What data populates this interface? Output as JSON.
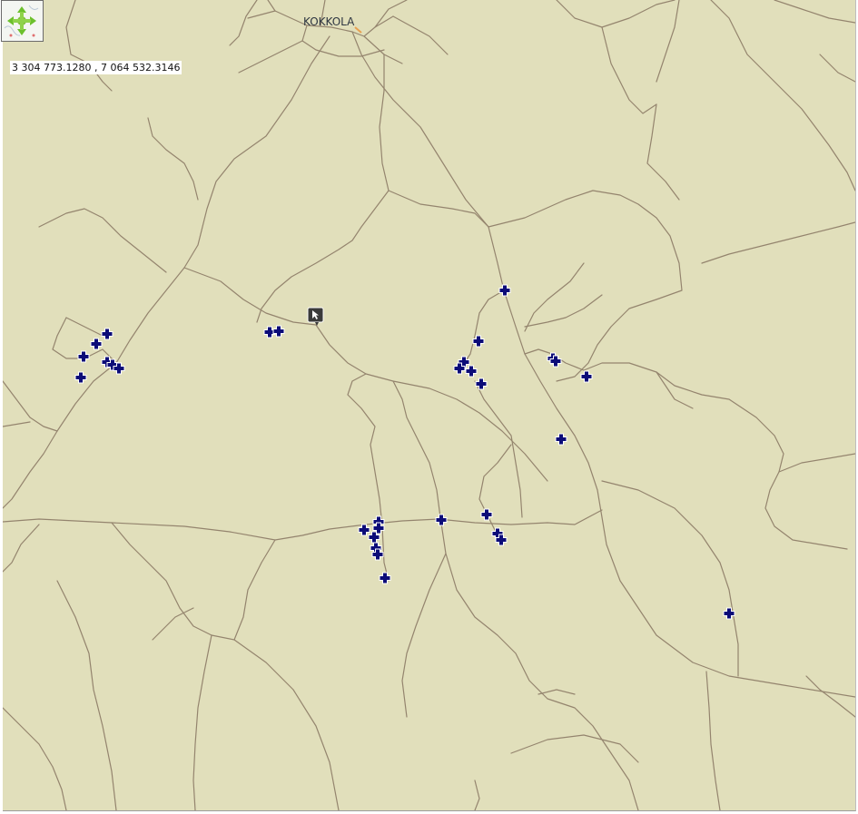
{
  "map": {
    "city_label": "KOKKOLA",
    "coordinate_readout": "3 304 773.1280 , 7 064 532.3146",
    "background_color": "#e1dfbb",
    "road_color": "#8c7b66",
    "marker_color": "#0c0c78"
  },
  "icons": {
    "navigation": "pan-navigation-icon",
    "cursor": "pointer-cursor-icon",
    "marker": "location-cross-marker-icon"
  }
}
